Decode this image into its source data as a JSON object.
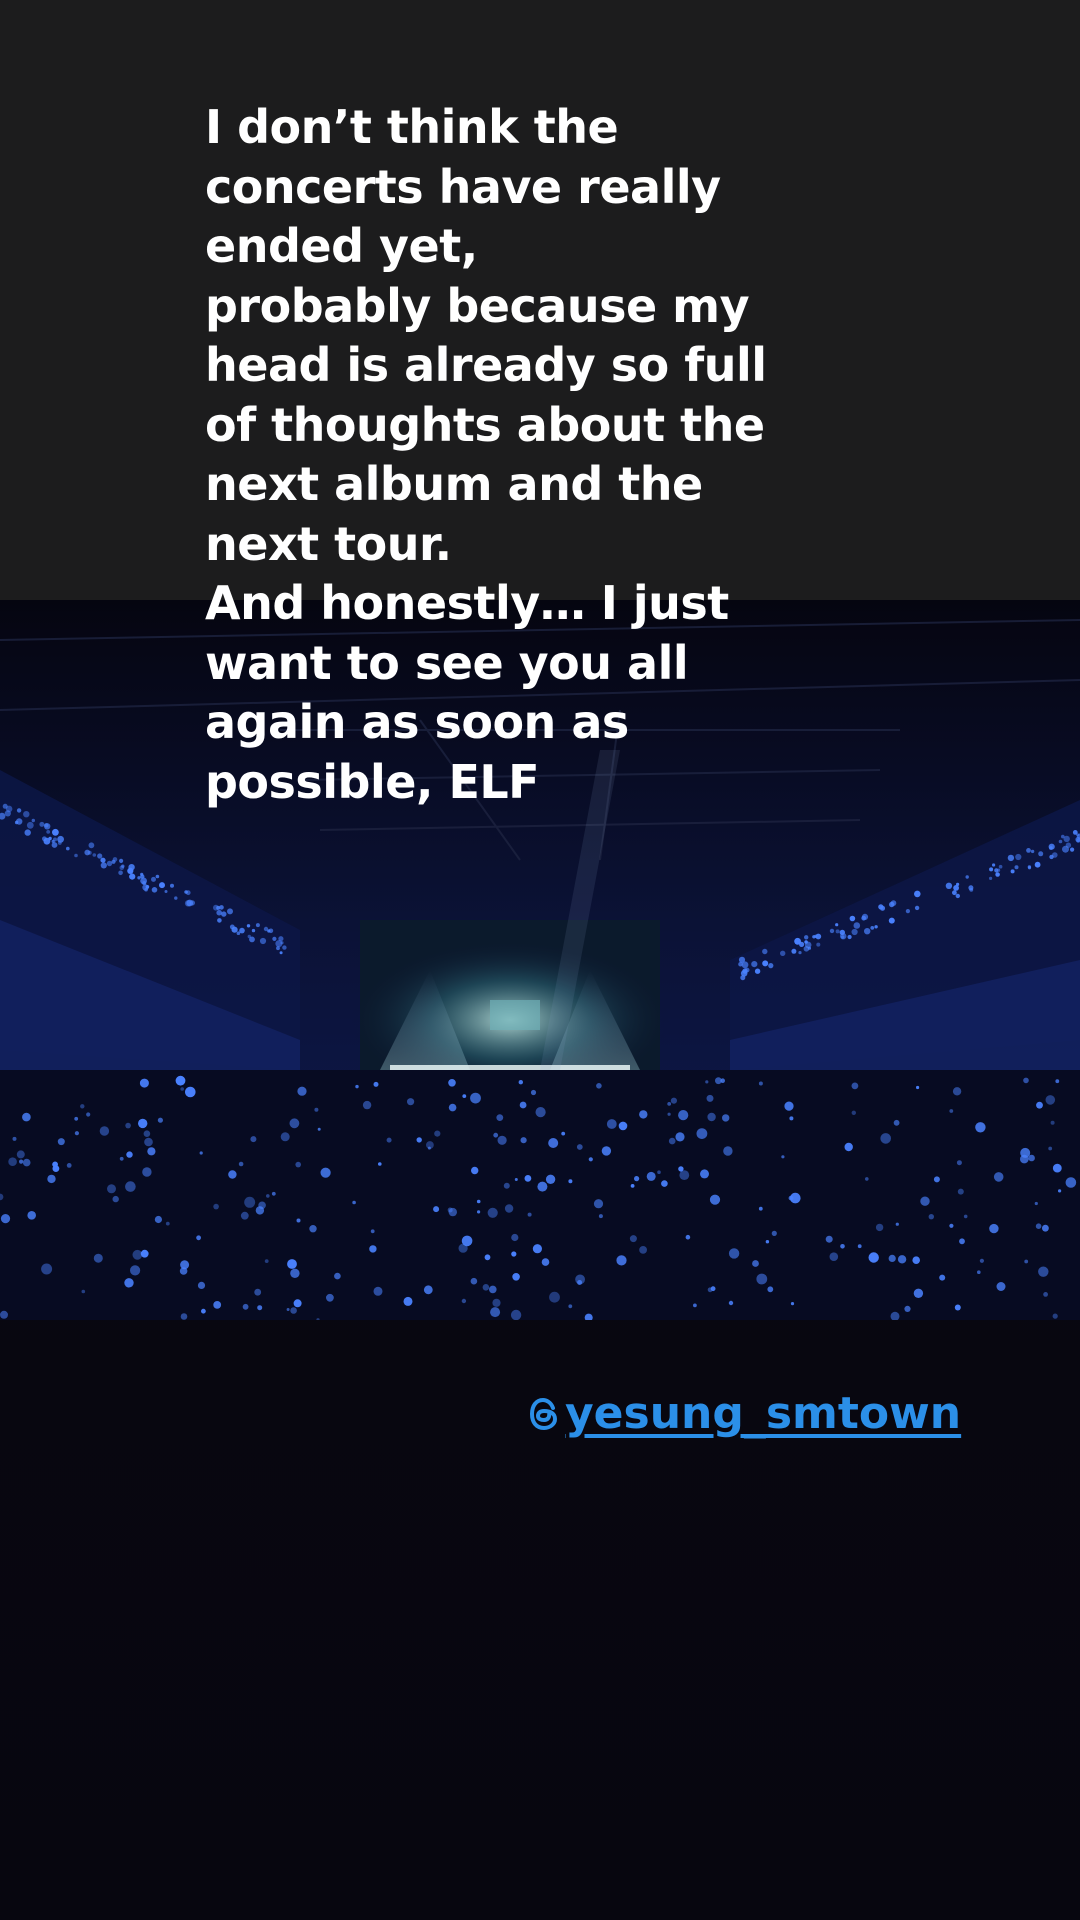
{
  "caption": {
    "lines": [
      "I don’t think the",
      "concerts have really",
      "ended yet,",
      "probably because my",
      "head is already so full",
      "of thoughts about the",
      "next album and the",
      "next tour.",
      "And honestly… I just",
      "want to see you all",
      "again as soon as",
      "possible, ELF"
    ]
  },
  "mention": {
    "icon": "threads-icon",
    "handle": "yesung_smtown",
    "color": "#2b8fe8"
  },
  "colors": {
    "top_band": "#1c1c1d",
    "background": "#07060f",
    "lightstick_blue": "#3a6bff"
  }
}
